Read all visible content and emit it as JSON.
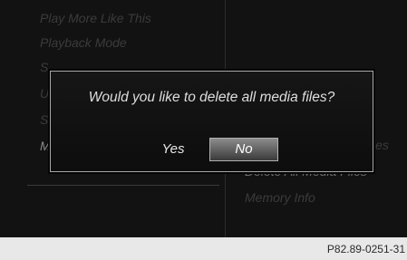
{
  "left_menu": {
    "items": [
      "Play More Like This",
      "Playback Mode",
      "S",
      "U",
      "S",
      "M"
    ]
  },
  "right_menu": {
    "items": [
      "les",
      "Delete All Media Files",
      "Memory Info"
    ]
  },
  "dialog": {
    "question": "Would you like to delete all media files?",
    "yes_label": "Yes",
    "no_label": "No",
    "selected": "No"
  },
  "caption": "P82.89-0251-31"
}
